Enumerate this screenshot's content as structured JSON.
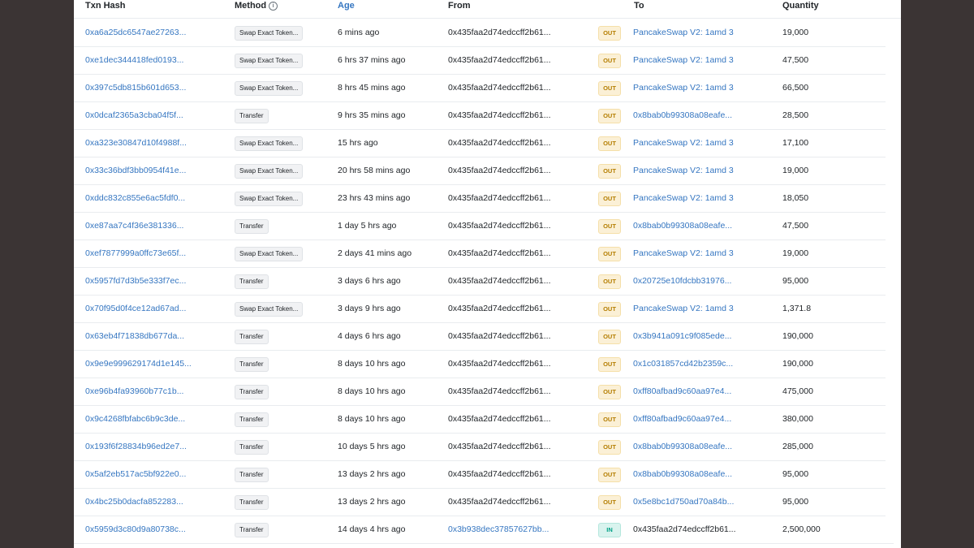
{
  "headers": {
    "txn_hash": "Txn Hash",
    "method": "Method",
    "age": "Age",
    "from": "From",
    "to": "To",
    "quantity": "Quantity"
  },
  "colors": {
    "link": "#3576c1",
    "out_badge_bg": "#fbf0d6",
    "out_badge_text": "#b47d00",
    "in_badge_bg": "#d9f3ee",
    "in_badge_text": "#00a186"
  },
  "rows": [
    {
      "hash": "0xa6a25dc6547ae27263...",
      "method": "Swap Exact Token...",
      "age": "6 mins ago",
      "from": "0x435faa2d74edccff2b61...",
      "from_link": false,
      "dir": "OUT",
      "to": "PancakeSwap V2: 1amd 3",
      "to_link": true,
      "qty": "19,000"
    },
    {
      "hash": "0xe1dec344418fed0193...",
      "method": "Swap Exact Token...",
      "age": "6 hrs 37 mins ago",
      "from": "0x435faa2d74edccff2b61...",
      "from_link": false,
      "dir": "OUT",
      "to": "PancakeSwap V2: 1amd 3",
      "to_link": true,
      "qty": "47,500"
    },
    {
      "hash": "0x397c5db815b601d653...",
      "method": "Swap Exact Token...",
      "age": "8 hrs 45 mins ago",
      "from": "0x435faa2d74edccff2b61...",
      "from_link": false,
      "dir": "OUT",
      "to": "PancakeSwap V2: 1amd 3",
      "to_link": true,
      "qty": "66,500"
    },
    {
      "hash": "0x0dcaf2365a3cba04f5f...",
      "method": "Transfer",
      "age": "9 hrs 35 mins ago",
      "from": "0x435faa2d74edccff2b61...",
      "from_link": false,
      "dir": "OUT",
      "to": "0x8bab0b99308a08eafe...",
      "to_link": true,
      "qty": "28,500"
    },
    {
      "hash": "0xa323e30847d10f4988f...",
      "method": "Swap Exact Token...",
      "age": "15 hrs ago",
      "from": "0x435faa2d74edccff2b61...",
      "from_link": false,
      "dir": "OUT",
      "to": "PancakeSwap V2: 1amd 3",
      "to_link": true,
      "qty": "17,100"
    },
    {
      "hash": "0x33c36bdf3bb0954f41e...",
      "method": "Swap Exact Token...",
      "age": "20 hrs 58 mins ago",
      "from": "0x435faa2d74edccff2b61...",
      "from_link": false,
      "dir": "OUT",
      "to": "PancakeSwap V2: 1amd 3",
      "to_link": true,
      "qty": "19,000"
    },
    {
      "hash": "0xddc832c855e6ac5fdf0...",
      "method": "Swap Exact Token...",
      "age": "23 hrs 43 mins ago",
      "from": "0x435faa2d74edccff2b61...",
      "from_link": false,
      "dir": "OUT",
      "to": "PancakeSwap V2: 1amd 3",
      "to_link": true,
      "qty": "18,050"
    },
    {
      "hash": "0xe87aa7c4f36e381336...",
      "method": "Transfer",
      "age": "1 day 5 hrs ago",
      "from": "0x435faa2d74edccff2b61...",
      "from_link": false,
      "dir": "OUT",
      "to": "0x8bab0b99308a08eafe...",
      "to_link": true,
      "qty": "47,500"
    },
    {
      "hash": "0xef7877999a0ffc73e65f...",
      "method": "Swap Exact Token...",
      "age": "2 days 41 mins ago",
      "from": "0x435faa2d74edccff2b61...",
      "from_link": false,
      "dir": "OUT",
      "to": "PancakeSwap V2: 1amd 3",
      "to_link": true,
      "qty": "19,000"
    },
    {
      "hash": "0x5957fd7d3b5e333f7ec...",
      "method": "Transfer",
      "age": "3 days 6 hrs ago",
      "from": "0x435faa2d74edccff2b61...",
      "from_link": false,
      "dir": "OUT",
      "to": "0x20725e10fdcbb31976...",
      "to_link": true,
      "qty": "95,000"
    },
    {
      "hash": "0x70f95d0f4ce12ad67ad...",
      "method": "Swap Exact Token...",
      "age": "3 days 9 hrs ago",
      "from": "0x435faa2d74edccff2b61...",
      "from_link": false,
      "dir": "OUT",
      "to": "PancakeSwap V2: 1amd 3",
      "to_link": true,
      "qty": "1,371.8"
    },
    {
      "hash": "0x63eb4f71838db677da...",
      "method": "Transfer",
      "age": "4 days 6 hrs ago",
      "from": "0x435faa2d74edccff2b61...",
      "from_link": false,
      "dir": "OUT",
      "to": "0x3b941a091c9f085ede...",
      "to_link": true,
      "qty": "190,000"
    },
    {
      "hash": "0x9e9e999629174d1e145...",
      "method": "Transfer",
      "age": "8 days 10 hrs ago",
      "from": "0x435faa2d74edccff2b61...",
      "from_link": false,
      "dir": "OUT",
      "to": "0x1c031857cd42b2359c...",
      "to_link": true,
      "qty": "190,000"
    },
    {
      "hash": "0xe96b4fa93960b77c1b...",
      "method": "Transfer",
      "age": "8 days 10 hrs ago",
      "from": "0x435faa2d74edccff2b61...",
      "from_link": false,
      "dir": "OUT",
      "to": "0xff80afbad9c60aa97e4...",
      "to_link": true,
      "qty": "475,000"
    },
    {
      "hash": "0x9c4268fbfabc6b9c3de...",
      "method": "Transfer",
      "age": "8 days 10 hrs ago",
      "from": "0x435faa2d74edccff2b61...",
      "from_link": false,
      "dir": "OUT",
      "to": "0xff80afbad9c60aa97e4...",
      "to_link": true,
      "qty": "380,000"
    },
    {
      "hash": "0x193f6f28834b96ed2e7...",
      "method": "Transfer",
      "age": "10 days 5 hrs ago",
      "from": "0x435faa2d74edccff2b61...",
      "from_link": false,
      "dir": "OUT",
      "to": "0x8bab0b99308a08eafe...",
      "to_link": true,
      "qty": "285,000"
    },
    {
      "hash": "0x5af2eb517ac5bf922e0...",
      "method": "Transfer",
      "age": "13 days 2 hrs ago",
      "from": "0x435faa2d74edccff2b61...",
      "from_link": false,
      "dir": "OUT",
      "to": "0x8bab0b99308a08eafe...",
      "to_link": true,
      "qty": "95,000"
    },
    {
      "hash": "0x4bc25b0dacfa852283...",
      "method": "Transfer",
      "age": "13 days 2 hrs ago",
      "from": "0x435faa2d74edccff2b61...",
      "from_link": false,
      "dir": "OUT",
      "to": "0x5e8bc1d750ad70a84b...",
      "to_link": true,
      "qty": "95,000"
    },
    {
      "hash": "0x5959d3c80d9a80738c...",
      "method": "Transfer",
      "age": "14 days 4 hrs ago",
      "from": "0x3b938dec37857627bb...",
      "from_link": true,
      "dir": "IN",
      "to": "0x435faa2d74edccff2b61...",
      "to_link": false,
      "qty": "2,500,000"
    }
  ]
}
